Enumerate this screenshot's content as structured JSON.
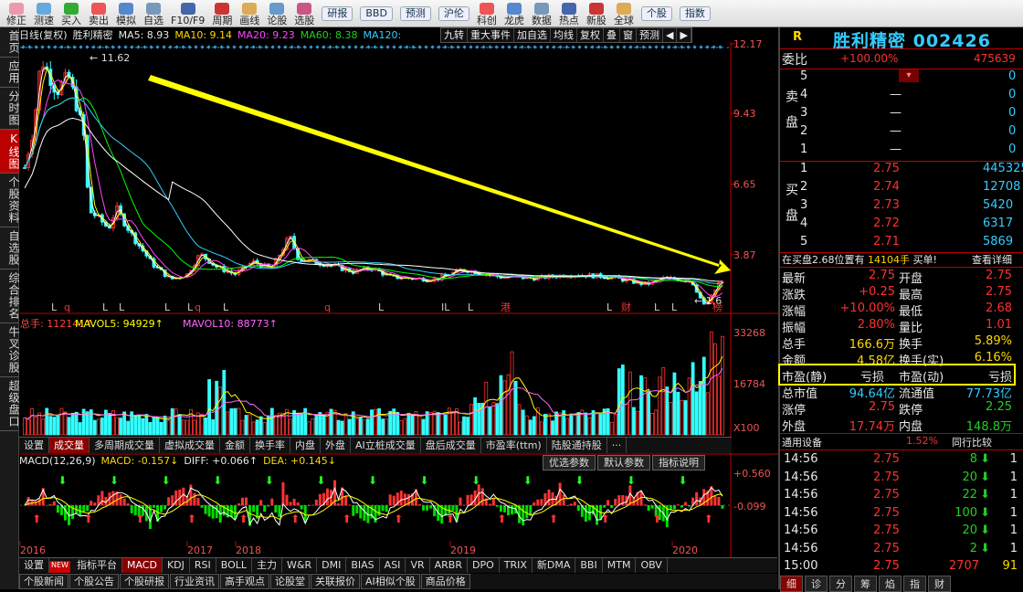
{
  "toolbar": {
    "buttons": [
      "修正",
      "测速",
      "买入",
      "卖出",
      "模拟",
      "自选",
      "F10/F9",
      "周期",
      "画线",
      "论股",
      "选股",
      "研报",
      "BBD",
      "预测",
      "沪伦",
      "科创",
      "龙虎",
      "数据",
      "热点",
      "新股",
      "全球",
      "个股",
      "指数"
    ]
  },
  "leftnav": [
    "首页",
    "应用",
    "分时图",
    "K线图",
    "个股资料",
    "自选股",
    "综合排名",
    "牛叉诊股",
    "超级盘口"
  ],
  "chart_head": {
    "period": "日线(复权)",
    "name": "胜利精密",
    "ma5": "MA5: 8.93",
    "ma10": "MA10: 9.14",
    "ma20": "MA20: 9.23",
    "ma60": "MA60: 8.38",
    "ma120": "MA120:"
  },
  "chart_buttons": [
    "九转",
    "重大事件",
    "加自选",
    "均线",
    "复权",
    "叠",
    "窗",
    "预测",
    "◀",
    "▶"
  ],
  "price_axis": [
    "12.17",
    "9.43",
    "6.65",
    "3.87"
  ],
  "price_high": "11.62",
  "price_low": "1.6",
  "markers": {
    "l": "L",
    "q": "q",
    "gang": "港",
    "cai": "财",
    "bang": "榜",
    "il": "IL"
  },
  "vol_head": {
    "total": "总手: 112141↑",
    "mavol5": "MAVOL5: 94929↑",
    "mavol10": "MAVOL10: 88773↑"
  },
  "vol_axis": [
    "33268",
    "16784",
    "X100"
  ],
  "vol_tabs": [
    "设置",
    "成交量",
    "多周期成交量",
    "虚拟成交量",
    "金额",
    "换手率",
    "内盘",
    "外盘",
    "AI立桩成交量",
    "盘后成交量",
    "市盈率(ttm)",
    "陆股通持股",
    "···"
  ],
  "macd_head": {
    "params": "MACD(12,26,9)",
    "macd": "MACD: -0.157↓",
    "diff": "DIFF: +0.066↑",
    "dea": "DEA: +0.145↓"
  },
  "macd_buttons": [
    "优选参数",
    "默认参数",
    "指标说明"
  ],
  "macd_axis": [
    "0.560",
    "-0.099"
  ],
  "years": [
    "2016",
    "2017",
    "2018",
    "2019",
    "2020"
  ],
  "ind_tabs": [
    "设置",
    "指标平台",
    "MACD",
    "KDJ",
    "RSI",
    "BOLL",
    "主力",
    "W&R",
    "DMI",
    "BIAS",
    "ASI",
    "VR",
    "ARBR",
    "DPO",
    "TRIX",
    "新DMA",
    "BBI",
    "MTM",
    "OBV"
  ],
  "ind_new": "NEW",
  "news_tabs": [
    "个股新闻",
    "个股公告",
    "个股研报",
    "行业资讯",
    "高手观点",
    "论股堂",
    "关联报价",
    "AI相似个股",
    "商品价格"
  ],
  "quote": {
    "r": "R",
    "title": "胜利精密",
    "code": "002426",
    "weibi_label": "委比",
    "weibi": "+100.00%",
    "weicha": "475639",
    "sell_label": "卖盘",
    "buy_label": "买盘",
    "sells": [
      {
        "n": "5",
        "p": "",
        "v": "0"
      },
      {
        "n": "4",
        "p": "—",
        "v": "0"
      },
      {
        "n": "3",
        "p": "—",
        "v": "0"
      },
      {
        "n": "2",
        "p": "—",
        "v": "0"
      },
      {
        "n": "1",
        "p": "—",
        "v": "0"
      }
    ],
    "buys": [
      {
        "n": "1",
        "p": "2.75",
        "v": "445325"
      },
      {
        "n": "2",
        "p": "2.74",
        "v": "12708"
      },
      {
        "n": "3",
        "p": "2.73",
        "v": "5420"
      },
      {
        "n": "4",
        "p": "2.72",
        "v": "6317"
      },
      {
        "n": "5",
        "p": "2.71",
        "v": "5869"
      }
    ],
    "info_a": "在买盘2.68位置有",
    "info_b": "14104手",
    "info_c": "买单!",
    "info_d": "查看详细",
    "stats": [
      [
        "最新",
        "2.75",
        "开盘",
        "2.75"
      ],
      [
        "涨跌",
        "+0.25",
        "最高",
        "2.75"
      ],
      [
        "涨幅",
        "+10.00%",
        "最低",
        "2.68"
      ],
      [
        "振幅",
        "2.80%",
        "量比",
        "1.01"
      ],
      [
        "总手",
        "166.6万",
        "换手",
        "5.89%"
      ],
      [
        "金额",
        "4.58亿",
        "换手(实)",
        "6.16%"
      ],
      [
        "市盈(静)",
        "亏损",
        "市盈(动)",
        "亏损"
      ],
      [
        "总市值",
        "94.64亿",
        "流通值",
        "77.73亿"
      ],
      [
        "涨停",
        "2.75",
        "跌停",
        "2.25"
      ],
      [
        "外盘",
        "17.74万",
        "内盘",
        "148.8万"
      ]
    ],
    "industry": "通用设备",
    "industry_pct": "1.52%",
    "compare": "同行比较",
    "ticks": [
      [
        "14:56",
        "2.75",
        "8"
      ],
      [
        "14:56",
        "2.75",
        "20"
      ],
      [
        "14:56",
        "2.75",
        "22"
      ],
      [
        "14:56",
        "2.75",
        "100"
      ],
      [
        "14:56",
        "2.75",
        "20"
      ],
      [
        "14:56",
        "2.75",
        "2"
      ],
      [
        "15:00",
        "2.75",
        "2707"
      ]
    ],
    "tick_last_extra": "91",
    "tick_side": "1",
    "bottom_tabs": [
      "细",
      "诊",
      "分",
      "筹",
      "焰",
      "指",
      "财"
    ]
  },
  "chart_data": {
    "type": "candlestick",
    "ylim": [
      1.6,
      12.17
    ],
    "yticks": [
      12.17,
      9.43,
      6.65,
      3.87
    ],
    "x_ticks": [
      "2016",
      "2017",
      "2018",
      "2019",
      "2020"
    ],
    "high": 11.62,
    "low": 1.6
  }
}
